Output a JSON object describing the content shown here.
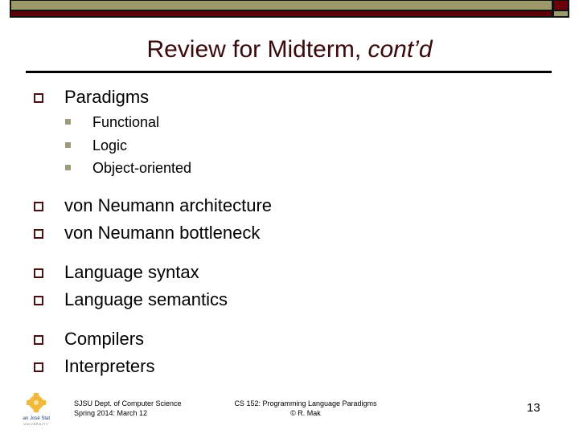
{
  "slide": {
    "title_main": "Review for Midterm, ",
    "title_italic": "cont’d",
    "bullets": [
      {
        "label": "Paradigms",
        "subs": [
          "Functional",
          "Logic",
          "Object-oriented"
        ]
      },
      {
        "label": "von Neumann architecture"
      },
      {
        "label": "von Neumann bottleneck"
      },
      {
        "label": "Language syntax"
      },
      {
        "label": "Language semantics"
      },
      {
        "label": "Compilers"
      },
      {
        "label": "Interpreters"
      }
    ]
  },
  "footer": {
    "logo_text": "San José State",
    "logo_sub": "UNIVERSITY",
    "dept_line1": "SJSU Dept. of Computer Science",
    "dept_line2": "Spring 2014: March 12",
    "course_line1": "CS 152: Programming Language Paradigms",
    "course_line2": "© R. Mak",
    "page_number": "13"
  },
  "colors": {
    "khaki": "#9c9a6a",
    "maroon": "#5e0008",
    "title": "#3a0a0a"
  }
}
